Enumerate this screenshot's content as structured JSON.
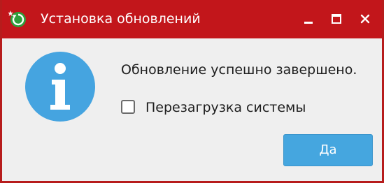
{
  "window": {
    "title": "Установка обновлений",
    "icon": "refresh-icon",
    "controls": [
      "minimize-icon",
      "maximize-icon",
      "close-icon"
    ],
    "accent_color": "#c2161b"
  },
  "dialog": {
    "icon": "info-icon",
    "message": "Обновление успешно завершено.",
    "reboot_checkbox": {
      "label": "Перезагрузка системы",
      "checked": false
    },
    "ok_button_label": "Да",
    "button_color": "#45a6df"
  }
}
